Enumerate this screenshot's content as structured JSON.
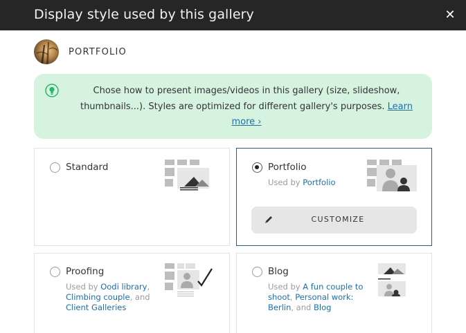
{
  "dialog": {
    "title": "Display style used by this gallery",
    "close_icon": "close-icon",
    "close_glyph": "✕"
  },
  "gallery": {
    "name": "PORTFOLIO",
    "avatar": "gallery-avatar"
  },
  "tip": {
    "icon": "lightbulb-icon",
    "text": "Chose how to present images/videos in this gallery (size, slideshow, thumbnails...). Styles are optimized for different gallery's purposes. ",
    "link": "Learn more ›"
  },
  "styles": [
    {
      "label": "Standard",
      "selected": false,
      "thumb": "standard-thumbnail"
    },
    {
      "label": "Portfolio",
      "selected": true,
      "thumb": "portfolio-thumbnail",
      "used_prefix": "Used by ",
      "used_links": [
        "Portfolio"
      ],
      "customize_label": "CUSTOMIZE",
      "customize_icon": "pencil-icon"
    },
    {
      "label": "Proofing",
      "selected": false,
      "thumb": "proofing-thumbnail",
      "used_prefix": "Used by ",
      "used_links": [
        "Oodi library",
        "Climbing couple",
        "Client Galleries"
      ],
      "sep1": ",",
      "sep2": ", and"
    },
    {
      "label": "Blog",
      "selected": false,
      "thumb": "blog-thumbnail",
      "used_prefix": "Used by ",
      "used_links": [
        "A fun couple to shoot",
        "Personal work: Berlin",
        "Blog"
      ],
      "sep1": ",",
      "sep2": ", and"
    }
  ],
  "colors": {
    "titlebar": "#262626",
    "tip_bg": "#d6f3e0",
    "link": "#1d6fa5",
    "selected_border": "#1d5f84"
  }
}
